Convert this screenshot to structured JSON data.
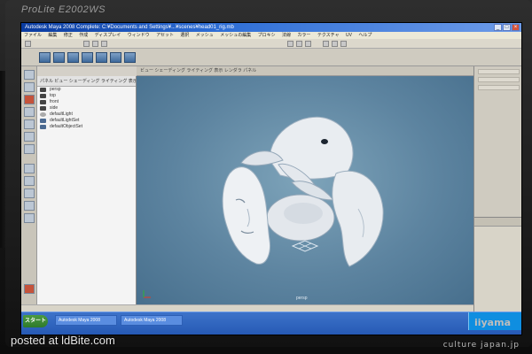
{
  "monitor": {
    "model": "ProLite E2002WS",
    "brand": "iiyama"
  },
  "window": {
    "title": "Autodesk Maya 2008 Complete: C:¥Documents and Settings¥...¥scenes¥head01_rig.mb",
    "controls": [
      "_",
      "□",
      "×"
    ]
  },
  "menubar": {
    "items": [
      "ファイル",
      "編集",
      "修正",
      "作成",
      "ディスプレイ",
      "ウィンドウ",
      "アセット",
      "選択",
      "メッシュ",
      "メッシュの編集",
      "プロキシ",
      "法線",
      "カラー",
      "テクスチャ",
      "UV",
      "ヘルプ"
    ]
  },
  "outliner": {
    "header": "パネル ビュー シェーディング ライティング 表示 レンダラ",
    "items": [
      {
        "label": "persp",
        "icon": "camera-icon"
      },
      {
        "label": "top",
        "icon": "camera-icon"
      },
      {
        "label": "front",
        "icon": "camera-icon"
      },
      {
        "label": "side",
        "icon": "camera-icon"
      },
      {
        "label": "defaultLight",
        "icon": "light-icon"
      },
      {
        "label": "defaultLightSet",
        "icon": "set-icon"
      },
      {
        "label": "defaultObjectSet",
        "icon": "set-icon"
      }
    ]
  },
  "viewport": {
    "menu": "ビュー  シェーディング  ライティング  表示  レンダラ  パネル",
    "axis": "persp"
  },
  "taskbar": {
    "start": "スタート",
    "tasks": [
      "Autodesk Maya 2008",
      "Autodesk Maya 2008"
    ]
  },
  "photo": {
    "caption": "posted at ldBite.com",
    "watermark": "culture japan.jp"
  },
  "colors": {
    "viewport_bg": "#5d84a0",
    "mesh": "#e6eaef",
    "xp_blue": "#2457b3",
    "start_green": "#2e7a2a"
  }
}
